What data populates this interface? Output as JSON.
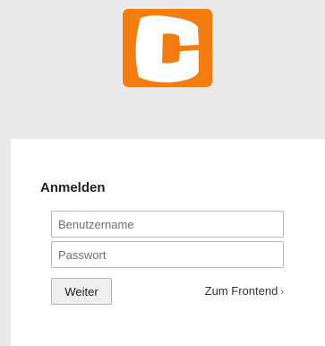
{
  "brand": {
    "logo_letter": "C",
    "accent_color": "#f47c0f"
  },
  "login": {
    "title": "Anmelden",
    "username_placeholder": "Benutzername",
    "password_placeholder": "Passwort",
    "submit_label": "Weiter",
    "frontend_link": "Zum Frontend",
    "frontend_chevron": "›"
  }
}
